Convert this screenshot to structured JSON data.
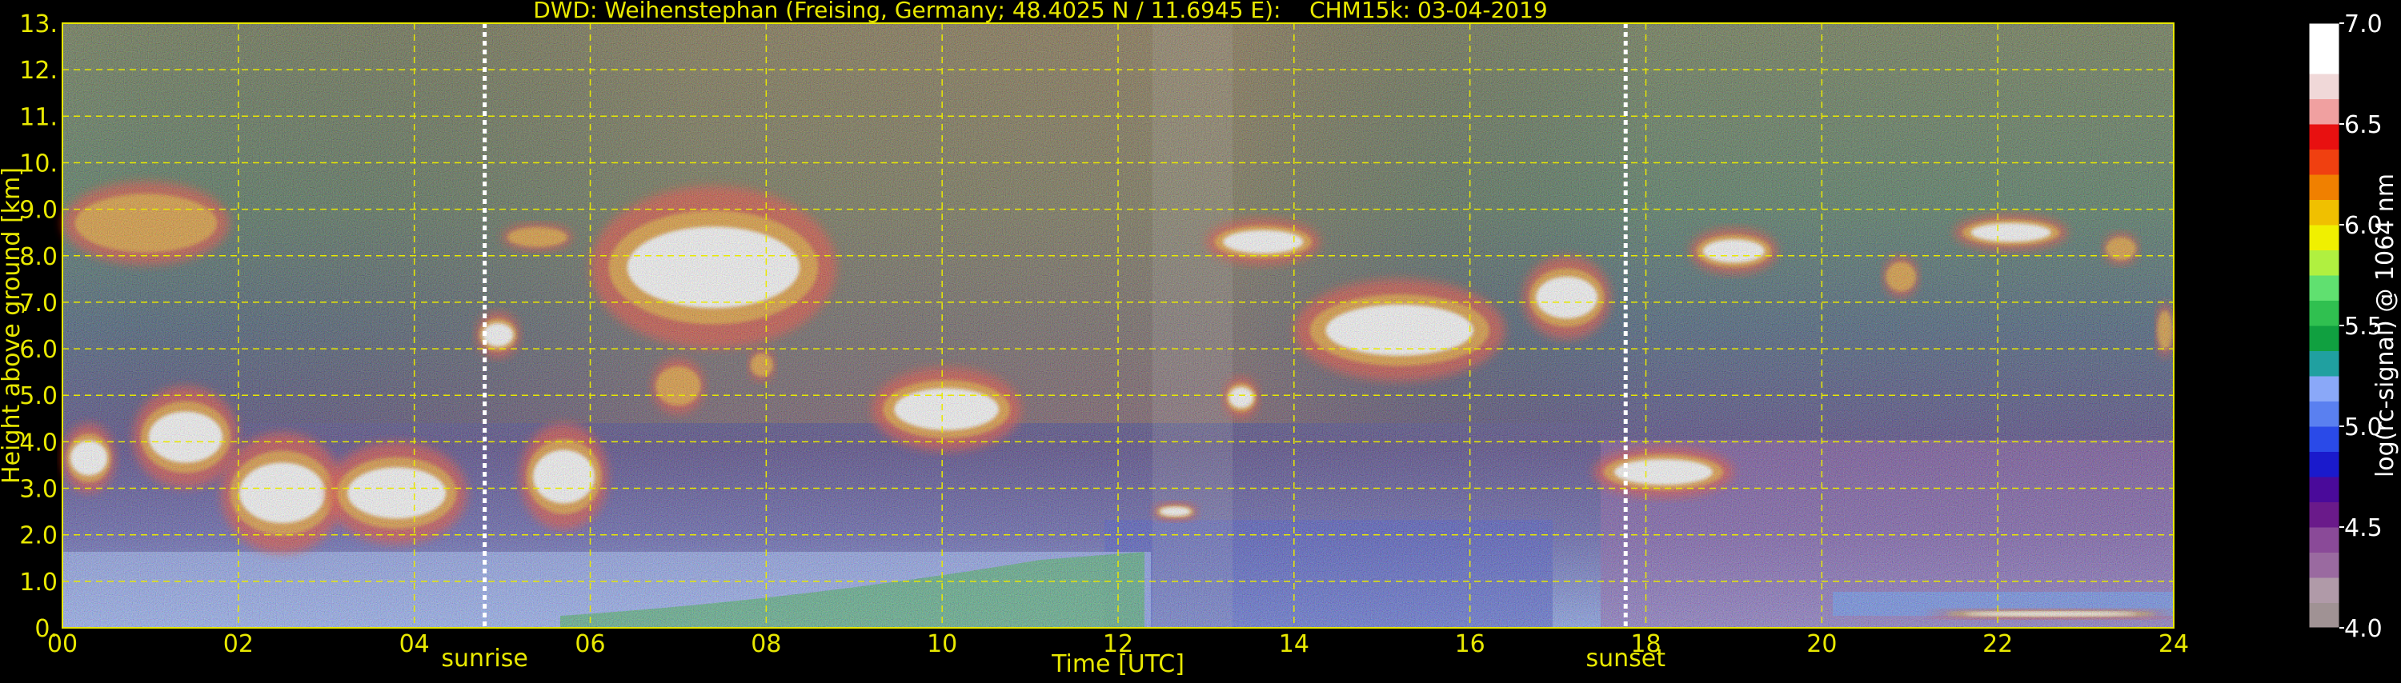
{
  "chart_data": {
    "type": "heatmap",
    "title": "DWD: Weihenstephan (Freising, Germany; 48.4025 N / 11.6945 E):    CHM15k: 03-04-2019",
    "xlabel": "Time [UTC]",
    "ylabel": "Height above ground [km]",
    "xlim": [
      0,
      24
    ],
    "ylim": [
      0,
      13
    ],
    "x_ticks": [
      "00",
      "02",
      "04",
      "06",
      "08",
      "10",
      "12",
      "14",
      "16",
      "18",
      "20",
      "22",
      "24"
    ],
    "x_tick_values": [
      0,
      2,
      4,
      6,
      8,
      10,
      12,
      14,
      16,
      18,
      20,
      22,
      24
    ],
    "y_ticks": [
      "0.",
      "1.0",
      "2.0",
      "3.0",
      "4.0",
      "5.0",
      "6.0",
      "7.0",
      "8.0",
      "9.0",
      "10.",
      "11.",
      "12.",
      "13."
    ],
    "y_tick_values": [
      0,
      1,
      2,
      3,
      4,
      5,
      6,
      7,
      8,
      9,
      10,
      11,
      12,
      13
    ],
    "grid": true,
    "annotations": [
      {
        "label": "sunrise",
        "time": 4.8
      },
      {
        "label": "sunset",
        "time": 17.77
      }
    ],
    "colorbar": {
      "label": "log(rc-signal) @ 1064 nm",
      "range": [
        4.0,
        7.0
      ],
      "ticks": [
        "4.0",
        "4.5",
        "5.0",
        "5.5",
        "6.0",
        "6.5",
        "7.0"
      ],
      "tick_values": [
        4.0,
        4.5,
        5.0,
        5.5,
        6.0,
        6.5,
        7.0
      ],
      "colors": [
        "#a09294",
        "#b09aa8",
        "#9a6aa0",
        "#8a4a98",
        "#6a1a8a",
        "#4a0a9a",
        "#1a1acc",
        "#2a4ae8",
        "#5a80f0",
        "#8aa8f8",
        "#20a0a0",
        "#10a040",
        "#30c050",
        "#60e070",
        "#b0f040",
        "#f0f000",
        "#f0c000",
        "#f08000",
        "#f04010",
        "#e81010",
        "#f0a0a0",
        "#f0d8d8",
        "#ffffff",
        "#ffffff"
      ]
    },
    "cloud_features": [
      {
        "t0": 0.0,
        "t1": 0.6,
        "base": 2.9,
        "top": 4.4,
        "intensity": 7.0
      },
      {
        "t0": 0.8,
        "t1": 2.0,
        "base": 3.0,
        "top": 5.2,
        "intensity": 7.0
      },
      {
        "t0": 1.8,
        "t1": 3.2,
        "base": 1.6,
        "top": 4.2,
        "intensity": 7.0
      },
      {
        "t0": 3.0,
        "t1": 4.6,
        "base": 1.8,
        "top": 4.0,
        "intensity": 7.0
      },
      {
        "t0": 5.2,
        "t1": 6.2,
        "base": 2.1,
        "top": 4.4,
        "intensity": 7.0
      },
      {
        "t0": 4.7,
        "t1": 5.2,
        "base": 5.8,
        "top": 6.8,
        "intensity": 6.8
      },
      {
        "t0": 0.0,
        "t1": 1.9,
        "base": 7.8,
        "top": 9.6,
        "intensity": 6.2
      },
      {
        "t0": 5.0,
        "t1": 5.8,
        "base": 8.1,
        "top": 8.7,
        "intensity": 6.5
      },
      {
        "t0": 6.0,
        "t1": 8.8,
        "base": 6.0,
        "top": 9.5,
        "intensity": 7.0
      },
      {
        "t0": 6.7,
        "t1": 7.3,
        "base": 4.6,
        "top": 5.8,
        "intensity": 6.5
      },
      {
        "t0": 7.8,
        "t1": 8.1,
        "base": 5.3,
        "top": 6.0,
        "intensity": 6.5
      },
      {
        "t0": 9.2,
        "t1": 10.9,
        "base": 3.8,
        "top": 5.6,
        "intensity": 7.0
      },
      {
        "t0": 12.4,
        "t1": 12.9,
        "base": 2.3,
        "top": 2.7,
        "intensity": 6.8
      },
      {
        "t0": 13.0,
        "t1": 14.3,
        "base": 7.8,
        "top": 8.8,
        "intensity": 7.0
      },
      {
        "t0": 14.0,
        "t1": 16.4,
        "base": 5.3,
        "top": 7.5,
        "intensity": 7.0
      },
      {
        "t0": 13.2,
        "t1": 13.6,
        "base": 4.5,
        "top": 5.4,
        "intensity": 6.8
      },
      {
        "t0": 16.6,
        "t1": 17.6,
        "base": 6.2,
        "top": 8.0,
        "intensity": 7.0
      },
      {
        "t0": 17.4,
        "t1": 19.0,
        "base": 2.8,
        "top": 3.9,
        "intensity": 7.0
      },
      {
        "t0": 18.5,
        "t1": 19.5,
        "base": 7.6,
        "top": 8.6,
        "intensity": 6.8
      },
      {
        "t0": 20.7,
        "t1": 21.1,
        "base": 7.1,
        "top": 8.0,
        "intensity": 6.5
      },
      {
        "t0": 21.5,
        "t1": 22.8,
        "base": 8.1,
        "top": 8.9,
        "intensity": 6.8
      },
      {
        "t0": 23.2,
        "t1": 23.6,
        "base": 7.8,
        "top": 8.5,
        "intensity": 6.5
      },
      {
        "t0": 23.8,
        "t1": 24.0,
        "base": 5.8,
        "top": 7.0,
        "intensity": 6.5
      },
      {
        "t0": 21.2,
        "t1": 24.0,
        "base": 0.2,
        "top": 0.4,
        "intensity": 7.0
      }
    ]
  }
}
